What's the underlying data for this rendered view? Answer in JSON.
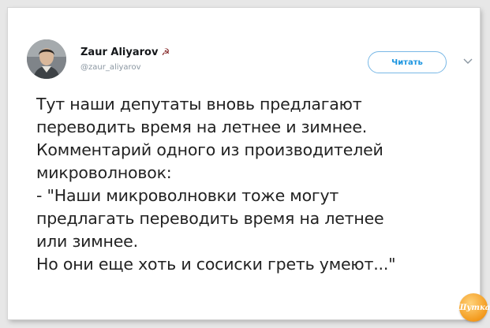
{
  "author": {
    "name": "Zaur Aliyarov",
    "flag_symbol": "☭",
    "handle": "@zaur_aliyarov"
  },
  "actions": {
    "follow_label": "Читать",
    "menu_icon": "chevron-down-icon"
  },
  "tweet": {
    "lines": [
      "Тут наши депутаты вновь предлагают",
      "переводить время на летнее и зимнее.",
      "Комментарий одного из производителей",
      "микроволновок:",
      "- \"Наши микроволновки тоже могут",
      "предлагать переводить время на летнее",
      "или зимнее.",
      "Но они еще хоть и сосиски греть умеют...\""
    ]
  },
  "watermark": {
    "text": "Шутка",
    "color": "#f39a1d"
  },
  "colors": {
    "accent": "#1b95e0",
    "text": "#222222",
    "muted": "#8a96a1"
  }
}
